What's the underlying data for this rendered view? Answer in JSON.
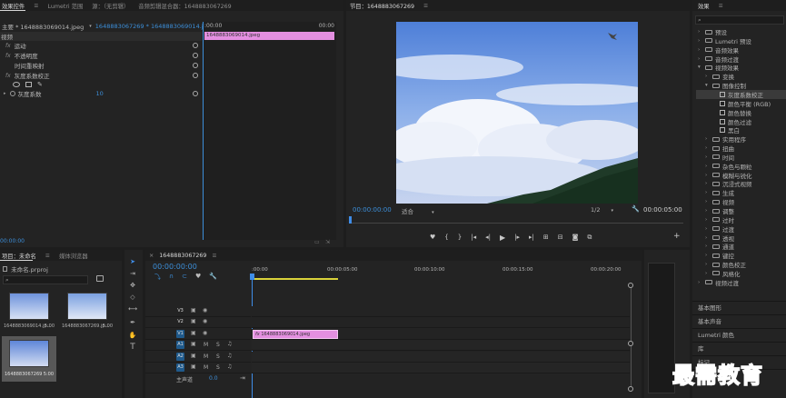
{
  "effect_controls": {
    "tabs": [
      {
        "label": "效果控件",
        "active": true
      },
      {
        "label": "≡",
        "active": false
      },
      {
        "label": "Lumetri 范围",
        "active": false
      },
      {
        "label": "源：（无剪辑）",
        "active": false
      },
      {
        "label": "音频剪辑混合器：1648883067269",
        "active": false
      }
    ],
    "master_label": "主要 * 1648883069014.jpeg",
    "clip_label": "1648883067269 * 1648883069014.jpeg",
    "timecode_start": ":00:00",
    "timecode_end": "00:00",
    "clip_bar_label": "1648883069014.jpeg",
    "section_video": "视频",
    "effects": [
      {
        "fx": "fx",
        "label": "运动"
      },
      {
        "fx": "fx",
        "label": "不透明度"
      },
      {
        "fx": "",
        "label": "时间重映射"
      },
      {
        "fx": "fx",
        "label": "灰度系数校正"
      }
    ],
    "param_label": "灰度系数",
    "param_value": "10",
    "footer_time": "00:00:00"
  },
  "program_monitor": {
    "title": "节目：1648883067269",
    "menu_icon": "≡",
    "timecode": "00:00:00:00",
    "fit_label": "适合",
    "fraction": "1/2",
    "duration": "00:00:05:00",
    "transport_icons": [
      "marker-icon",
      "mark-in-icon",
      "mark-out-icon",
      "go-to-in-icon",
      "step-back-icon",
      "play-icon",
      "step-forward-icon",
      "go-to-out-icon",
      "insert-icon",
      "overwrite-icon",
      "export-frame-icon",
      "comparison-icon"
    ]
  },
  "project_panel": {
    "tabs": [
      {
        "label": "项目：未命名",
        "active": true
      },
      {
        "label": "≡",
        "active": false
      },
      {
        "label": "媒体浏览器",
        "active": false
      }
    ],
    "project_file": "未命名.prproj",
    "items": [
      {
        "name": "1648883069014.jp...",
        "duration": "5:00"
      },
      {
        "name": "1648883067269.jp...",
        "duration": "5:00"
      },
      {
        "name": "1648883067269",
        "duration": "5:00"
      }
    ]
  },
  "timeline": {
    "sequence_name": "1648883067269",
    "close_icon": "×",
    "menu_icon": "≡",
    "timecode": "00:00:00:00",
    "ruler_labels": [
      ":00:00",
      "00:00:05:00",
      "00:00:10:00",
      "00:00:15:00",
      "00:00:20:00"
    ],
    "video_tracks": [
      "V3",
      "V2",
      "V1"
    ],
    "audio_tracks": [
      "A1",
      "A2",
      "A3"
    ],
    "master_label": "主声道",
    "master_value": "0.0",
    "clip_label": "1648883069014.jpeg",
    "toggle_m": "M",
    "toggle_s": "S"
  },
  "effects_panel": {
    "title": "效果",
    "menu_icon": "≡",
    "tree": [
      {
        "label": "预设",
        "level": 0,
        "type": "folder",
        "open": false
      },
      {
        "label": "Lumetri 预设",
        "level": 0,
        "type": "folder",
        "open": false
      },
      {
        "label": "音频效果",
        "level": 0,
        "type": "folder",
        "open": false
      },
      {
        "label": "音频过渡",
        "level": 0,
        "type": "folder",
        "open": false
      },
      {
        "label": "视频效果",
        "level": 0,
        "type": "folder",
        "open": true
      },
      {
        "label": "变换",
        "level": 1,
        "type": "folder",
        "open": false
      },
      {
        "label": "图像控制",
        "level": 1,
        "type": "folder",
        "open": true
      },
      {
        "label": "灰度系数校正",
        "level": 2,
        "type": "effect",
        "selected": true
      },
      {
        "label": "颜色平衡 (RGB)",
        "level": 2,
        "type": "effect"
      },
      {
        "label": "颜色替换",
        "level": 2,
        "type": "effect"
      },
      {
        "label": "颜色过滤",
        "level": 2,
        "type": "effect"
      },
      {
        "label": "黑白",
        "level": 2,
        "type": "effect"
      },
      {
        "label": "实用程序",
        "level": 1,
        "type": "folder",
        "open": false
      },
      {
        "label": "扭曲",
        "level": 1,
        "type": "folder",
        "open": false
      },
      {
        "label": "时间",
        "level": 1,
        "type": "folder",
        "open": false
      },
      {
        "label": "杂色与颗粒",
        "level": 1,
        "type": "folder",
        "open": false
      },
      {
        "label": "模糊与锐化",
        "level": 1,
        "type": "folder",
        "open": false
      },
      {
        "label": "沉浸式视频",
        "level": 1,
        "type": "folder",
        "open": false
      },
      {
        "label": "生成",
        "level": 1,
        "type": "folder",
        "open": false
      },
      {
        "label": "视频",
        "level": 1,
        "type": "folder",
        "open": false
      },
      {
        "label": "调整",
        "level": 1,
        "type": "folder",
        "open": false
      },
      {
        "label": "过时",
        "level": 1,
        "type": "folder",
        "open": false
      },
      {
        "label": "过渡",
        "level": 1,
        "type": "folder",
        "open": false
      },
      {
        "label": "透视",
        "level": 1,
        "type": "folder",
        "open": false
      },
      {
        "label": "通道",
        "level": 1,
        "type": "folder",
        "open": false
      },
      {
        "label": "键控",
        "level": 1,
        "type": "folder",
        "open": false
      },
      {
        "label": "颜色校正",
        "level": 1,
        "type": "folder",
        "open": false
      },
      {
        "label": "风格化",
        "level": 1,
        "type": "folder",
        "open": false
      },
      {
        "label": "视频过渡",
        "level": 0,
        "type": "folder",
        "open": false
      }
    ],
    "sections": [
      "基本图形",
      "基本声音",
      "Lumetri 颜色",
      "库",
      "标记",
      "信息"
    ]
  },
  "watermark": "最需教育",
  "colors": {
    "accent_blue": "#2d8ceb",
    "clip_pink": "#e48fe0",
    "track_blue": "#1f5a8c",
    "playhead": "#3f8de8"
  }
}
